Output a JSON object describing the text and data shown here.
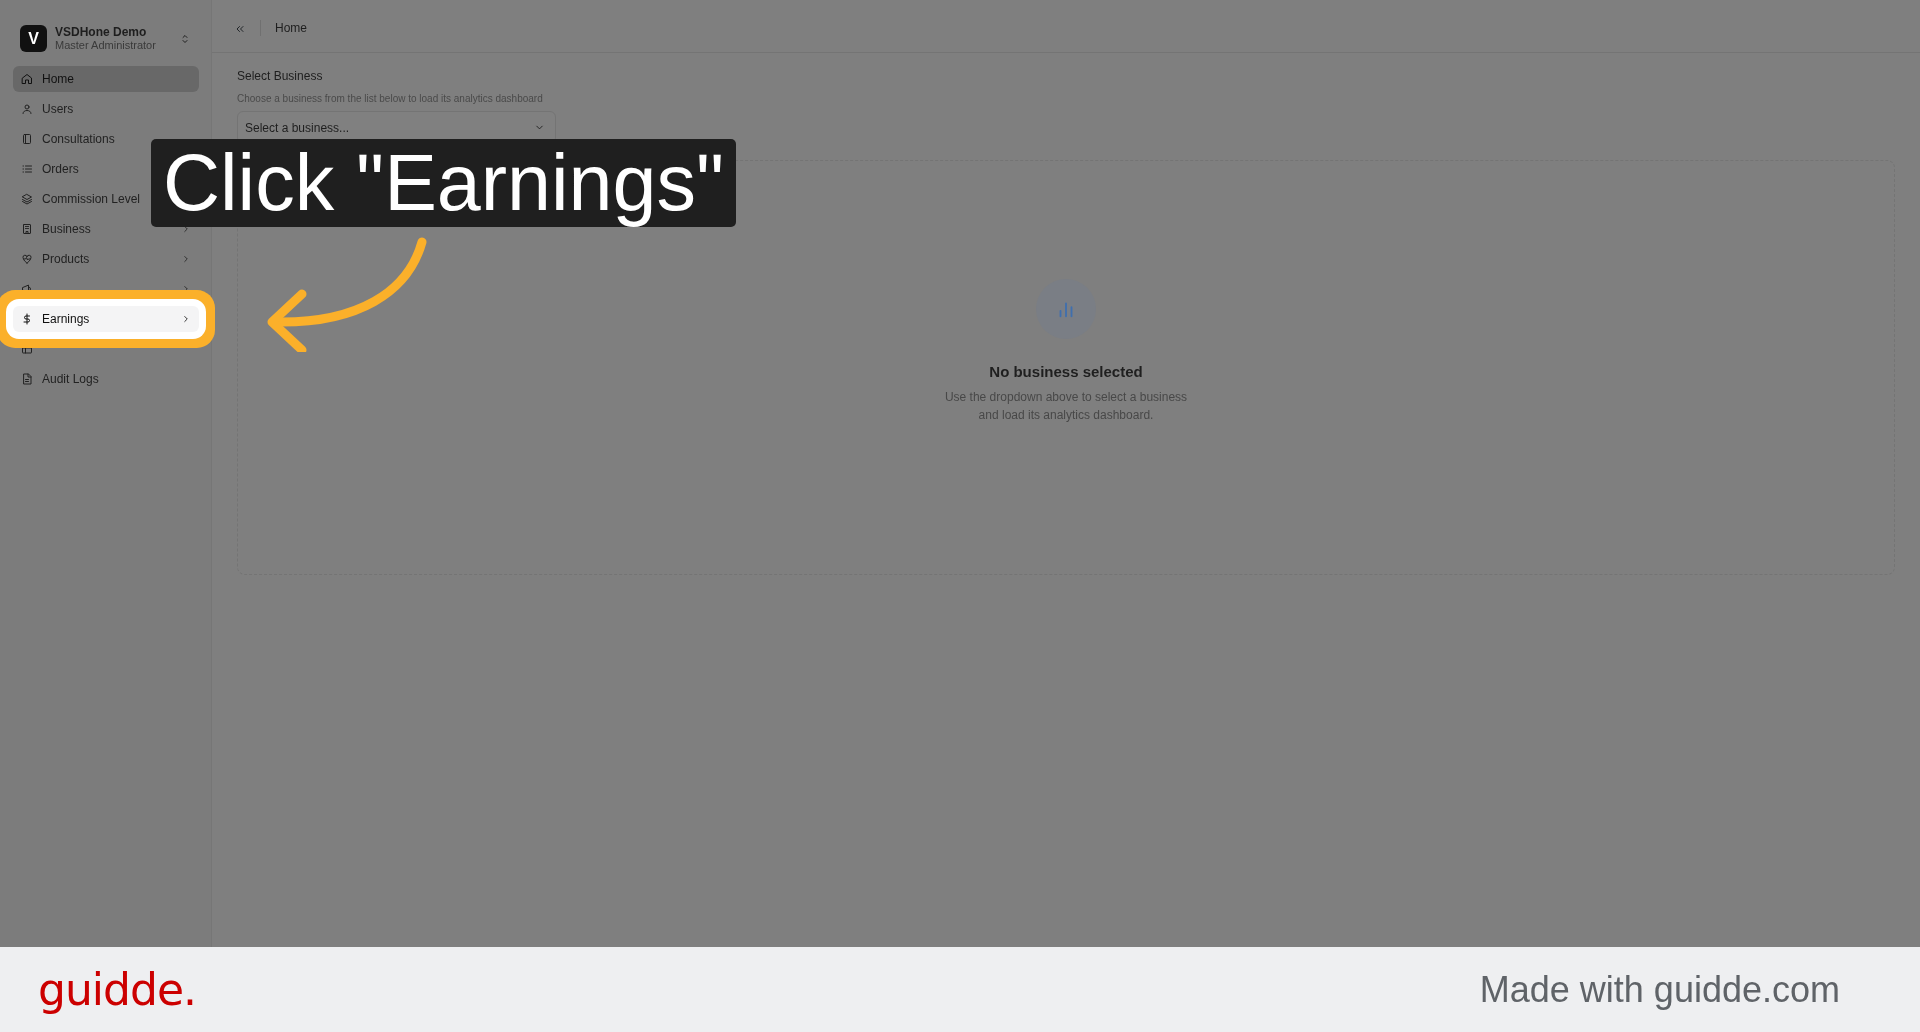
{
  "sidebar": {
    "org": {
      "initial": "V",
      "name": "VSDHone Demo",
      "role": "Master Administrator"
    },
    "items": [
      {
        "label": "Home",
        "selected": true,
        "submenu": false,
        "highlighted": false
      },
      {
        "label": "Users",
        "selected": false,
        "submenu": false,
        "highlighted": false
      },
      {
        "label": "Consultations",
        "selected": false,
        "submenu": false,
        "highlighted": false
      },
      {
        "label": "Orders",
        "selected": false,
        "submenu": false,
        "highlighted": false
      },
      {
        "label": "Commission Level",
        "selected": false,
        "submenu": false,
        "highlighted": false
      },
      {
        "label": "Business",
        "selected": false,
        "submenu": true,
        "highlighted": false
      },
      {
        "label": "Products",
        "selected": false,
        "submenu": true,
        "highlighted": false
      },
      {
        "selected": false,
        "submenu": true,
        "highlighted": false
      },
      {
        "label": "Earnings",
        "selected": false,
        "submenu": true,
        "highlighted": true
      },
      {
        "selected": false,
        "submenu": false,
        "highlighted": false
      },
      {
        "label": "Audit Logs",
        "selected": false,
        "submenu": false,
        "highlighted": false
      }
    ]
  },
  "topbar": {
    "breadcrumb": "Home"
  },
  "business_select": {
    "label": "Select Business",
    "hint": "Choose a business from the list below to load its analytics dashboard",
    "placeholder": "Select a business..."
  },
  "empty_state": {
    "title": "No business selected",
    "description": "Use the dropdown above to select a business and load its analytics dashboard."
  },
  "callout": {
    "text": "Click \"Earnings\""
  },
  "footer": {
    "logo": "guidde.",
    "tagline": "Made with guidde.com"
  }
}
